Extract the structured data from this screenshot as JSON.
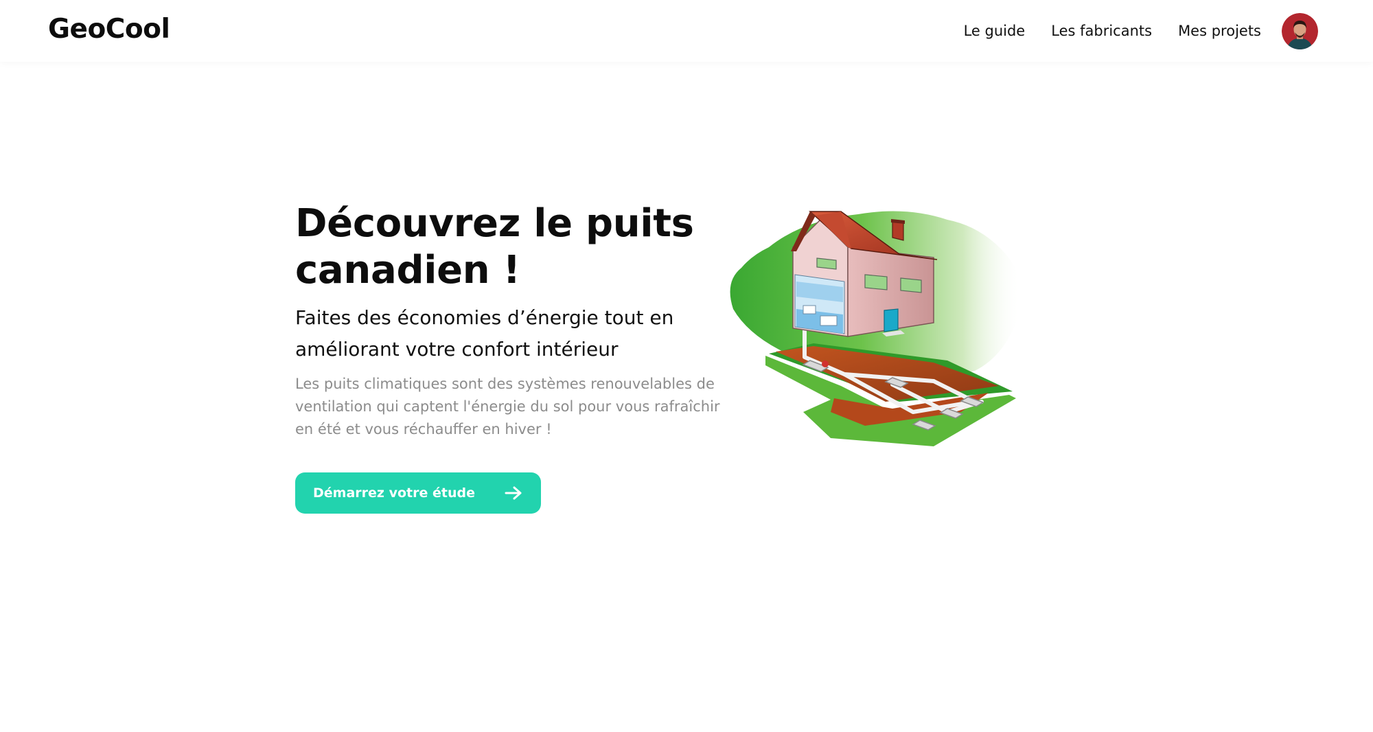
{
  "header": {
    "logo": "GeoCool",
    "nav": [
      {
        "label": "Le guide"
      },
      {
        "label": "Les fabricants"
      },
      {
        "label": "Mes projets"
      }
    ],
    "avatar_icon": "user-avatar"
  },
  "hero": {
    "title": "Découvrez le puits canadien !",
    "subtitle": "Faites des économies d’énergie tout en améliorant votre confort intérieur",
    "description": "Les puits climatiques sont des systèmes renouvelables de ventilation qui captent l'énergie du sol pour vous rafraîchir en été et vous réchauffer en hiver !",
    "cta_label": "Démarrez votre étude",
    "cta_icon": "arrow-right-icon",
    "illustration_icon": "house-ground-pipes-illustration"
  },
  "colors": {
    "accent": "#22d3ae",
    "text": "#111111",
    "muted": "#8c8c8c"
  }
}
